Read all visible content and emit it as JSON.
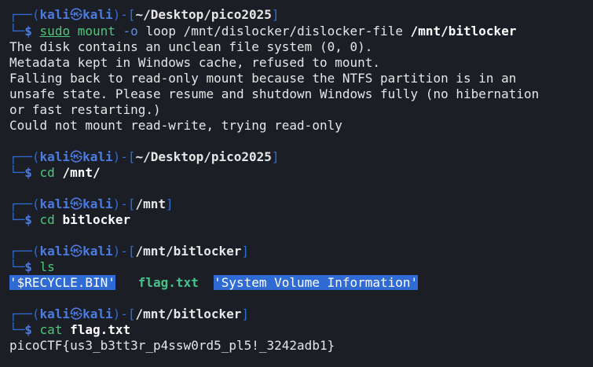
{
  "prompts": [
    {
      "user": "kali",
      "host": "kali",
      "dir": "~/Desktop/pico2025"
    },
    {
      "user": "kali",
      "host": "kali",
      "dir": "~/Desktop/pico2025"
    },
    {
      "user": "kali",
      "host": "kali",
      "dir": "/mnt"
    },
    {
      "user": "kali",
      "host": "kali",
      "dir": "/mnt/bitlocker"
    },
    {
      "user": "kali",
      "host": "kali",
      "dir": "/mnt/bitlocker"
    }
  ],
  "commands": {
    "c1": {
      "sudo": "sudo",
      "cmd": "mount",
      "opt": "-o",
      "args": "loop /mnt/dislocker/dislocker-file",
      "target": "/mnt/bitlocker"
    },
    "c2": {
      "cmd": "cd",
      "target": "/mnt/"
    },
    "c3": {
      "cmd": "cd",
      "target": "bitlocker"
    },
    "c4": {
      "cmd": "ls"
    },
    "c5": {
      "cmd": "cat",
      "target": "flag.txt"
    }
  },
  "output": {
    "mount_lines": [
      "The disk contains an unclean file system (0, 0).",
      "Metadata kept in Windows cache, refused to mount.",
      "Falling back to read-only mount because the NTFS partition is in an",
      "unsafe state. Please resume and shutdown Windows fully (no hibernation",
      "or fast restarting.)",
      "Could not mount read-write, trying read-only"
    ],
    "ls_entries": [
      "'$RECYCLE.BIN'",
      "flag.txt",
      "'System Volume Information'"
    ],
    "flag": "picoCTF{us3_b3tt3r_p4ssw0rd5_pl5!_3242adb1}"
  },
  "symbols": {
    "box_top": "┌──(",
    "box_bottom": "└─",
    "dollar": "$",
    "skull": "㉿",
    "close_user": ")-[",
    "close_dir": "]"
  }
}
